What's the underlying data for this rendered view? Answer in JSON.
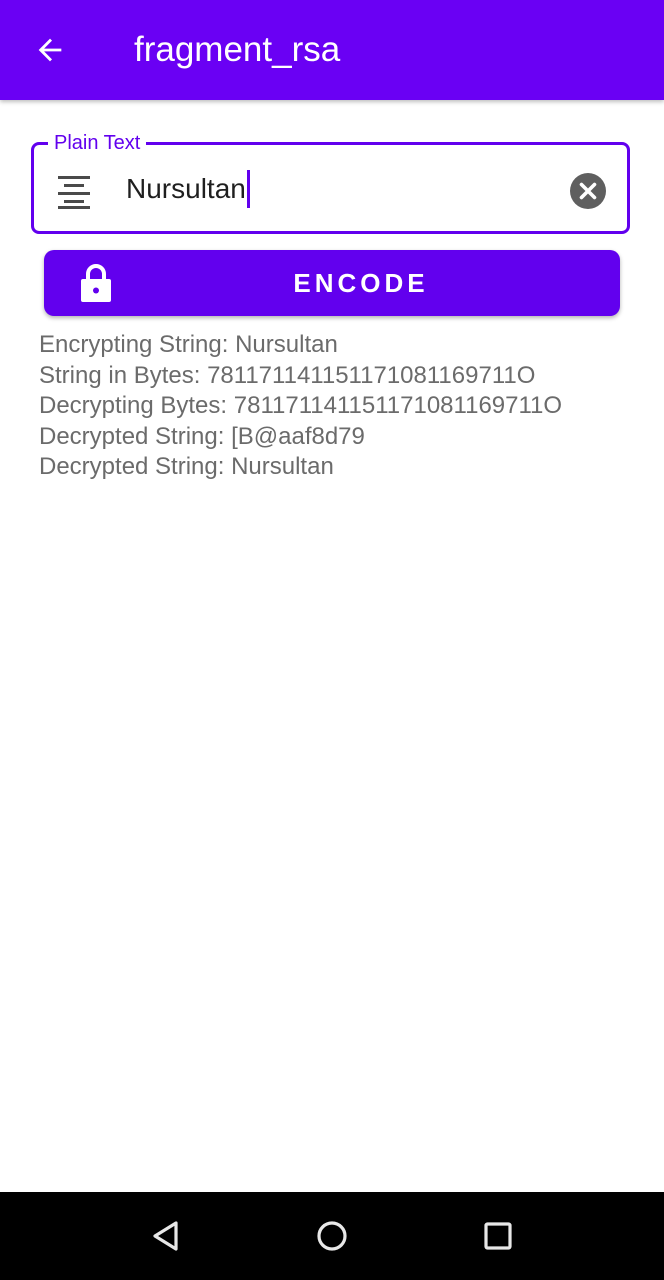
{
  "app_bar": {
    "title": "fragment_rsa",
    "back_icon": "arrow-back-icon",
    "color": "#6a00f4"
  },
  "input": {
    "label": "Plain Text",
    "value": "Nursultan",
    "start_icon": "format-align-center-icon",
    "clear_icon": "clear-circle-icon",
    "accent": "#6200ee"
  },
  "encode_button": {
    "label": "ENCODE",
    "icon": "lock-icon",
    "color": "#6200ee"
  },
  "output": {
    "lines": [
      "Encrypting String: Nursultan",
      "String in Bytes: 781171141151171081169711O",
      "Decrypting Bytes: 781171141151171081169711O",
      "Decrypted String: [B@aaf8d79",
      "Decrypted String: Nursultan"
    ]
  },
  "nav_bar": {
    "back_icon": "nav-back-triangle-icon",
    "home_icon": "nav-home-circle-icon",
    "recents_icon": "nav-recents-square-icon"
  }
}
